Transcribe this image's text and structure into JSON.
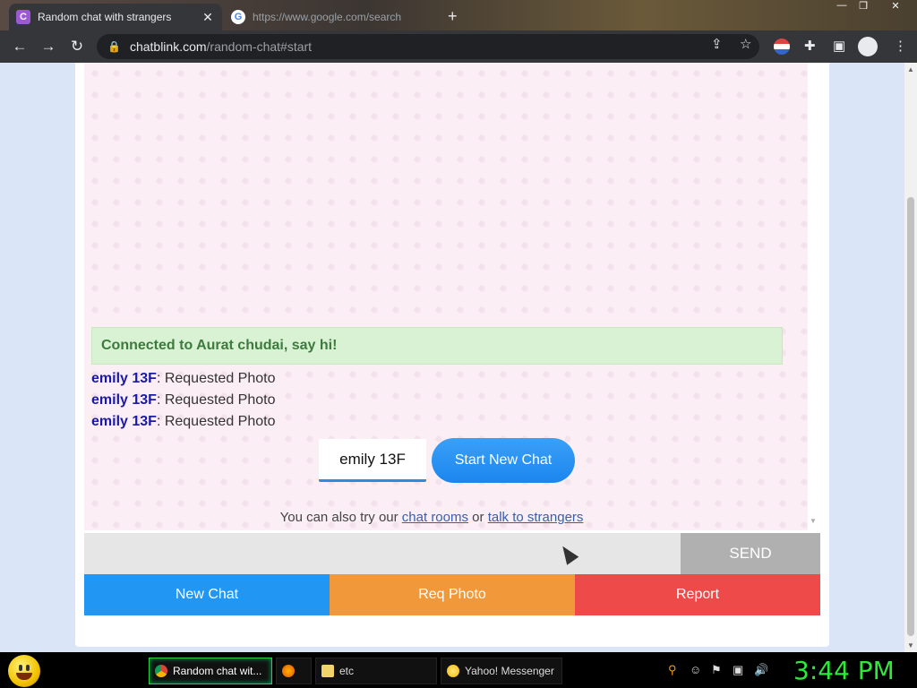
{
  "browser": {
    "tabs": [
      {
        "title": "Random chat with strangers",
        "favicon": "C"
      },
      {
        "title": "https://www.google.com/search",
        "favicon": "G"
      }
    ],
    "new_tab": "+",
    "url_host": "chatblink.com",
    "url_path": "/random-chat#start"
  },
  "chat": {
    "connected_text": "Connected to Aurat chudai, say hi!",
    "messages": [
      {
        "sender": "emily 13F",
        "text": ": Requested Photo"
      },
      {
        "sender": "emily 13F",
        "text": ": Requested Photo"
      },
      {
        "sender": "emily 13F",
        "text": ": Requested Photo"
      }
    ],
    "name_value": "emily 13F",
    "start_new_chat": "Start New Chat",
    "alt_prefix": "You can also try our",
    "alt_link1": "chat rooms",
    "alt_or": "or",
    "alt_link2": "talk to strangers",
    "send": "SEND",
    "new_chat": "New Chat",
    "req_photo": "Req Photo",
    "report": "Report"
  },
  "taskbar": {
    "items": [
      {
        "label": "Random chat wit...",
        "icon": "chrome-icon"
      },
      {
        "label": "",
        "icon": "firefox-icon"
      },
      {
        "label": "etc",
        "icon": "folder-icon"
      },
      {
        "label": "Yahoo! Messenger",
        "icon": "yahoo-messenger-icon"
      }
    ],
    "clock": "3:44 PM"
  },
  "colors": {
    "new_chat": "#2196f3",
    "req_photo": "#f0983a",
    "report": "#ef4a4a",
    "connected_bg": "#d9f2d4",
    "sender": "#1a1aa6",
    "clock": "#2ee83a"
  }
}
